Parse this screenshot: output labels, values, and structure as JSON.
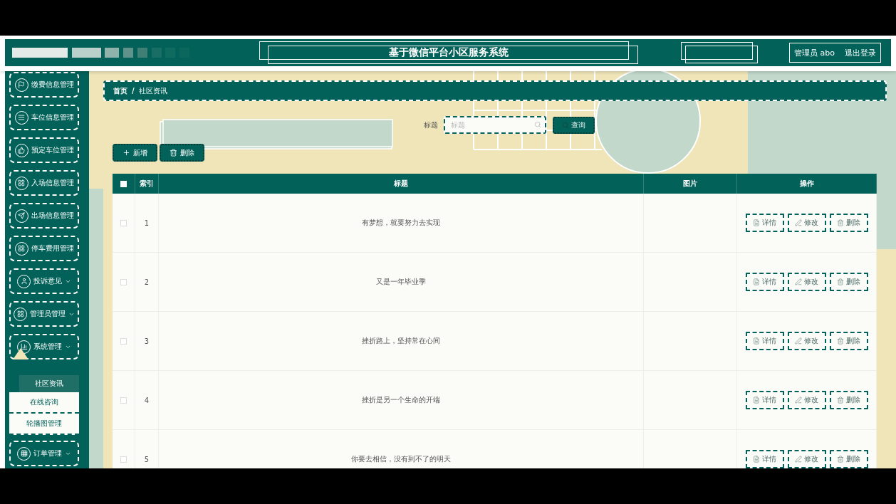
{
  "header": {
    "title": "基于微信平台小区服务系统",
    "user": "管理员 abo",
    "logout": "退出登录"
  },
  "sidebar": {
    "items": [
      {
        "label": "缴费信息管理",
        "kind": "link"
      },
      {
        "label": "车位信息管理",
        "kind": "link"
      },
      {
        "label": "预定车位管理",
        "kind": "link"
      },
      {
        "label": "入场信息管理",
        "kind": "link"
      },
      {
        "label": "出场信息管理",
        "kind": "link"
      },
      {
        "label": "停车费用管理",
        "kind": "link"
      },
      {
        "label": "投诉意见",
        "kind": "group"
      },
      {
        "label": "管理员管理",
        "kind": "group"
      },
      {
        "label": "系统管理",
        "kind": "group",
        "expanded": true,
        "children": [
          {
            "label": "社区资讯",
            "selected": true
          },
          {
            "label": "在线咨询",
            "selected": false
          },
          {
            "label": "轮播图管理",
            "selected": false
          }
        ]
      },
      {
        "label": "订单管理",
        "kind": "group"
      }
    ]
  },
  "breadcrumb": {
    "items": [
      "首页",
      "社区资讯"
    ],
    "separator": "/"
  },
  "search": {
    "label": "标题",
    "placeholder": "标题",
    "button": "查询"
  },
  "toolbar": {
    "buttons": [
      {
        "label": "新增",
        "kind": "add"
      },
      {
        "label": "删除",
        "kind": "delete"
      }
    ]
  },
  "table": {
    "all_checked": false,
    "columns": [
      "索引",
      "标题",
      "图片",
      "操作"
    ],
    "rows": [
      {
        "checked": false,
        "index": "1",
        "title": "有梦想，就要努力去实现",
        "actions": [
          {
            "label": "详情",
            "kind": "detail"
          },
          {
            "label": "修改",
            "kind": "edit"
          },
          {
            "label": "删除",
            "kind": "delete"
          }
        ]
      },
      {
        "checked": false,
        "index": "2",
        "title": "又是一年毕业季",
        "actions": [
          {
            "label": "详情",
            "kind": "detail"
          },
          {
            "label": "修改",
            "kind": "edit"
          },
          {
            "label": "删除",
            "kind": "delete"
          }
        ]
      },
      {
        "checked": false,
        "index": "3",
        "title": "挫折路上，坚持常在心间",
        "actions": [
          {
            "label": "详情",
            "kind": "detail"
          },
          {
            "label": "修改",
            "kind": "edit"
          },
          {
            "label": "删除",
            "kind": "delete"
          }
        ]
      },
      {
        "checked": false,
        "index": "4",
        "title": "挫折是另一个生命的开端",
        "actions": [
          {
            "label": "详情",
            "kind": "detail"
          },
          {
            "label": "修改",
            "kind": "edit"
          },
          {
            "label": "删除",
            "kind": "delete"
          }
        ]
      },
      {
        "checked": false,
        "index": "5",
        "title": "你要去相信，没有到不了的明天",
        "actions": [
          {
            "label": "详情",
            "kind": "detail"
          },
          {
            "label": "修改",
            "kind": "edit"
          },
          {
            "label": "删除",
            "kind": "delete"
          }
        ]
      }
    ]
  }
}
